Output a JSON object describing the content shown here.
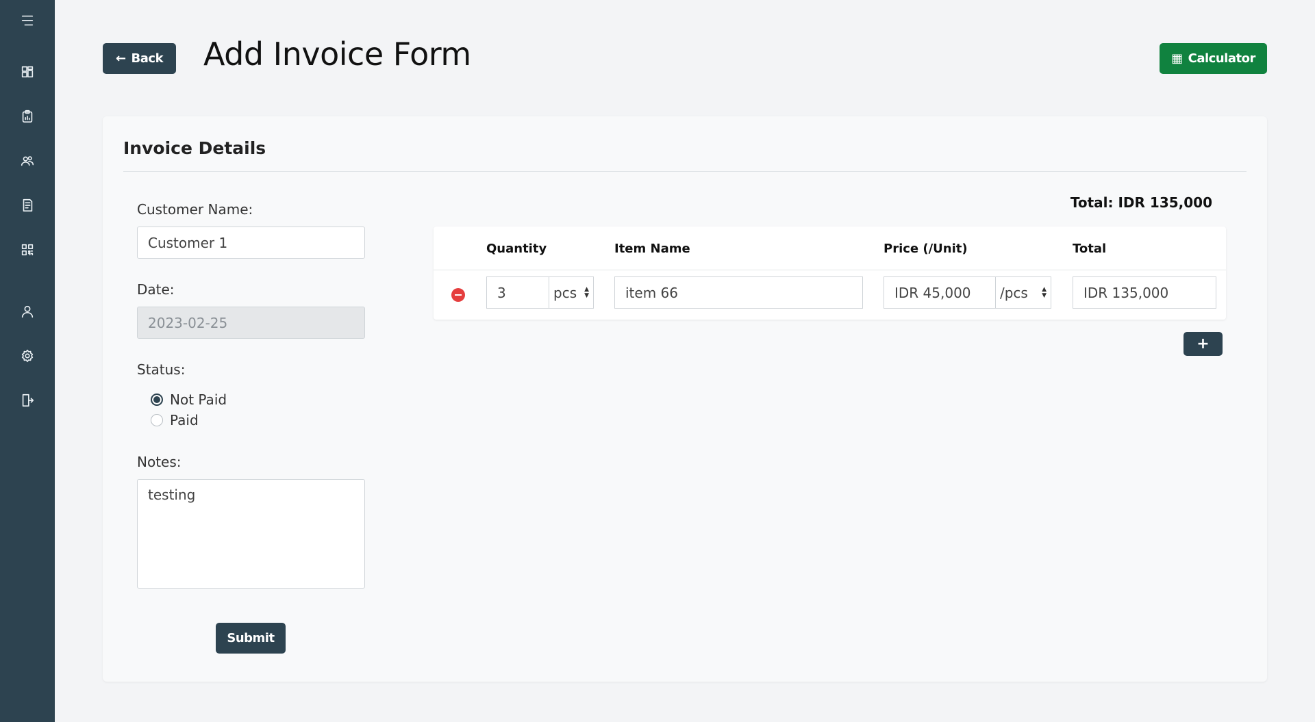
{
  "sidebar": {
    "items": [
      {
        "icon": "menu-icon"
      },
      {
        "icon": "dashboard-icon"
      },
      {
        "icon": "clipboard-icon"
      },
      {
        "icon": "users-icon"
      },
      {
        "icon": "invoice-icon"
      },
      {
        "icon": "qr-icon"
      },
      {
        "icon": "user-icon"
      },
      {
        "icon": "settings-icon"
      },
      {
        "icon": "logout-icon"
      }
    ]
  },
  "header": {
    "back_label": "Back",
    "title": "Add Invoice Form",
    "calculator_label": "Calculator"
  },
  "card": {
    "title": "Invoice Details",
    "total_label": "Total: IDR 135,000"
  },
  "form": {
    "customer_label": "Customer Name:",
    "customer_value": "Customer 1",
    "date_label": "Date:",
    "date_value": "2023-02-25",
    "status_label": "Status:",
    "status_options": [
      "Not Paid",
      "Paid"
    ],
    "status_selected": "Not Paid",
    "notes_label": "Notes:",
    "notes_value": "testing",
    "submit_label": "Submit"
  },
  "items_table": {
    "headers": [
      "Quantity",
      "Item Name",
      "Price (/Unit)",
      "Total"
    ],
    "rows": [
      {
        "quantity": "3",
        "unit": "pcs",
        "item_name": "item 66",
        "price": "IDR 45,000",
        "price_unit": "/pcs",
        "total": "IDR 135,000"
      }
    ],
    "add_label": "+"
  },
  "colors": {
    "sidebar": "#2d4350",
    "primary": "#2d4350",
    "calculator": "#10823f",
    "remove": "#e53e3e"
  }
}
